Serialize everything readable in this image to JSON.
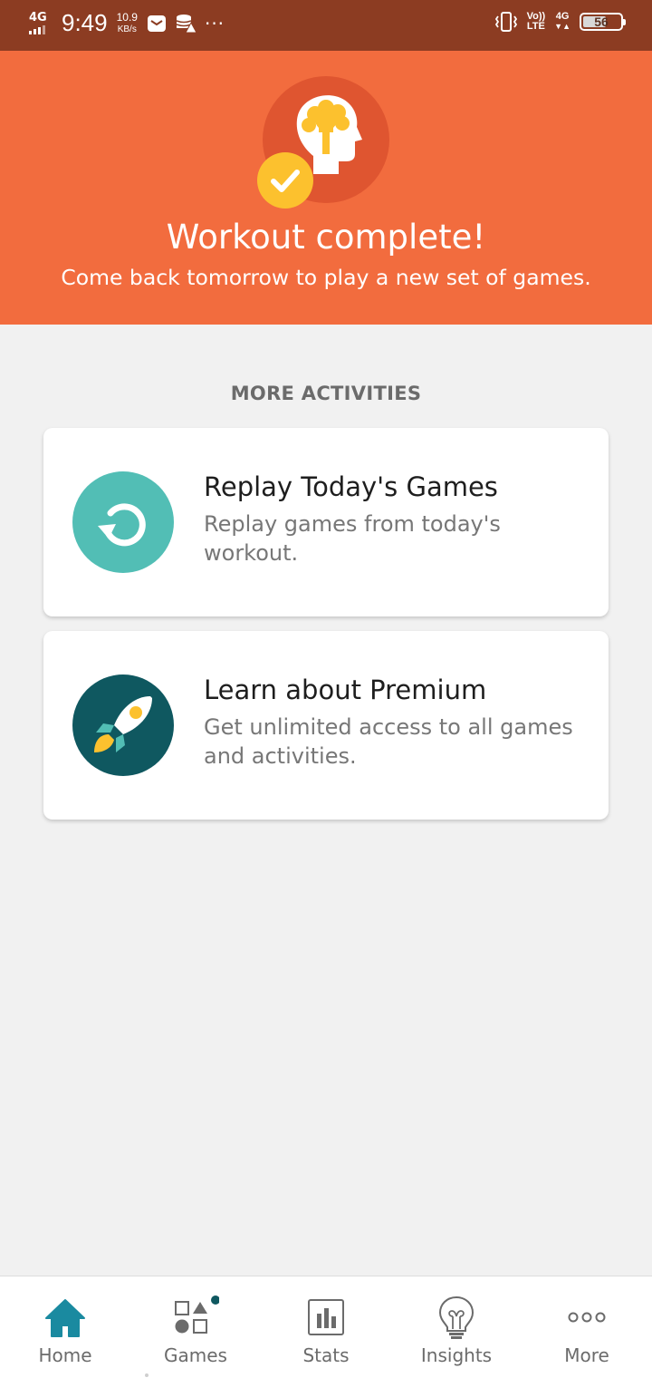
{
  "status_bar": {
    "network": "4G",
    "time": "9:49",
    "speed_value": "10.9",
    "speed_unit": "KB/s",
    "more_dots": "···",
    "volte_top": "Vo))",
    "volte_bottom": "LTE",
    "network_right": "4G",
    "battery": "56"
  },
  "hero": {
    "title": "Workout complete!",
    "subtitle": "Come back tomorrow to play a new set of games.",
    "logo_icon": "brain-head-icon",
    "badge_icon": "check-icon",
    "colors": {
      "background": "#f26c3e",
      "logo_circle": "#df5530",
      "badge": "#fcc12e"
    }
  },
  "activities": {
    "heading": "MORE ACTIVITIES",
    "cards": [
      {
        "title": "Replay Today's Games",
        "description": "Replay games from today's workout.",
        "icon": "replay-icon",
        "icon_color": "#52beb5"
      },
      {
        "title": "Learn about Premium",
        "description": "Get unlimited access to all games and activities.",
        "icon": "rocket-icon",
        "icon_color": "#0f5860"
      }
    ]
  },
  "bottom_nav": {
    "active": "Home",
    "accent": "#1a8aa0",
    "items": [
      {
        "label": "Home",
        "icon": "home-icon"
      },
      {
        "label": "Games",
        "icon": "games-icon"
      },
      {
        "label": "Stats",
        "icon": "stats-icon"
      },
      {
        "label": "Insights",
        "icon": "lightbulb-icon"
      },
      {
        "label": "More",
        "icon": "more-icon"
      }
    ]
  }
}
